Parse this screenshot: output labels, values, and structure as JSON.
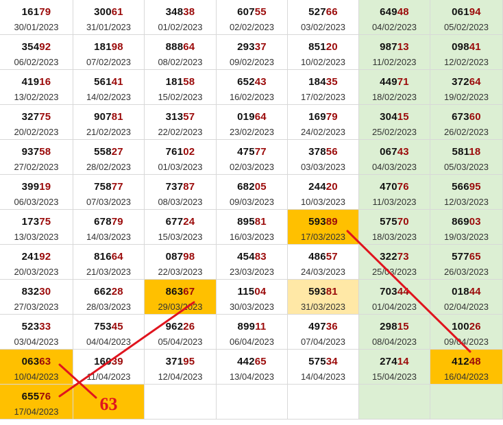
{
  "colors": {
    "weekend_bg": "#dcefd3",
    "highlight_bg": "#ffc000",
    "light_highlight_bg": "#ffe8a6",
    "digit_dark": "#111111",
    "digit_red": "#9b0a0a",
    "line_red": "#e0141e",
    "grid_line": "#d8d8d8"
  },
  "rows": [
    [
      {
        "first": "161",
        "last": "79",
        "date": "30/01/2023"
      },
      {
        "first": "300",
        "last": "61",
        "date": "31/01/2023"
      },
      {
        "first": "348",
        "last": "38",
        "date": "01/02/2023"
      },
      {
        "first": "607",
        "last": "55",
        "date": "02/02/2023"
      },
      {
        "first": "527",
        "last": "66",
        "date": "03/02/2023"
      },
      {
        "first": "649",
        "last": "48",
        "date": "04/02/2023"
      },
      {
        "first": "061",
        "last": "94",
        "date": "05/02/2023"
      }
    ],
    [
      {
        "first": "354",
        "last": "92",
        "date": "06/02/2023"
      },
      {
        "first": "181",
        "last": "98",
        "date": "07/02/2023"
      },
      {
        "first": "888",
        "last": "64",
        "date": "08/02/2023"
      },
      {
        "first": "293",
        "last": "37",
        "date": "09/02/2023"
      },
      {
        "first": "851",
        "last": "20",
        "date": "10/02/2023"
      },
      {
        "first": "987",
        "last": "13",
        "date": "11/02/2023"
      },
      {
        "first": "098",
        "last": "41",
        "date": "12/02/2023"
      }
    ],
    [
      {
        "first": "419",
        "last": "16",
        "date": "13/02/2023"
      },
      {
        "first": "561",
        "last": "41",
        "date": "14/02/2023"
      },
      {
        "first": "181",
        "last": "58",
        "date": "15/02/2023"
      },
      {
        "first": "652",
        "last": "43",
        "date": "16/02/2023"
      },
      {
        "first": "184",
        "last": "35",
        "date": "17/02/2023"
      },
      {
        "first": "449",
        "last": "71",
        "date": "18/02/2023"
      },
      {
        "first": "372",
        "last": "64",
        "date": "19/02/2023"
      }
    ],
    [
      {
        "first": "327",
        "last": "75",
        "date": "20/02/2023"
      },
      {
        "first": "907",
        "last": "81",
        "date": "21/02/2023"
      },
      {
        "first": "313",
        "last": "57",
        "date": "22/02/2023"
      },
      {
        "first": "019",
        "last": "64",
        "date": "23/02/2023"
      },
      {
        "first": "169",
        "last": "79",
        "date": "24/02/2023"
      },
      {
        "first": "304",
        "last": "15",
        "date": "25/02/2023"
      },
      {
        "first": "673",
        "last": "60",
        "date": "26/02/2023"
      }
    ],
    [
      {
        "first": "937",
        "last": "58",
        "date": "27/02/2023"
      },
      {
        "first": "558",
        "last": "27",
        "date": "28/02/2023"
      },
      {
        "first": "761",
        "last": "02",
        "date": "01/03/2023"
      },
      {
        "first": "475",
        "last": "77",
        "date": "02/03/2023"
      },
      {
        "first": "378",
        "last": "56",
        "date": "03/03/2023"
      },
      {
        "first": "067",
        "last": "43",
        "date": "04/03/2023"
      },
      {
        "first": "581",
        "last": "18",
        "date": "05/03/2023"
      }
    ],
    [
      {
        "first": "399",
        "last": "19",
        "date": "06/03/2023"
      },
      {
        "first": "758",
        "last": "77",
        "date": "07/03/2023"
      },
      {
        "first": "737",
        "last": "87",
        "date": "08/03/2023"
      },
      {
        "first": "682",
        "last": "05",
        "date": "09/03/2023"
      },
      {
        "first": "244",
        "last": "20",
        "date": "10/03/2023"
      },
      {
        "first": "470",
        "last": "76",
        "date": "11/03/2023"
      },
      {
        "first": "566",
        "last": "95",
        "date": "12/03/2023"
      }
    ],
    [
      {
        "first": "173",
        "last": "75",
        "date": "13/03/2023"
      },
      {
        "first": "678",
        "last": "79",
        "date": "14/03/2023"
      },
      {
        "first": "677",
        "last": "24",
        "date": "15/03/2023"
      },
      {
        "first": "895",
        "last": "81",
        "date": "16/03/2023"
      },
      {
        "first": "593",
        "last": "89",
        "date": "17/03/2023",
        "hl": "strong"
      },
      {
        "first": "575",
        "last": "70",
        "date": "18/03/2023"
      },
      {
        "first": "869",
        "last": "03",
        "date": "19/03/2023"
      }
    ],
    [
      {
        "first": "241",
        "last": "92",
        "date": "20/03/2023"
      },
      {
        "first": "816",
        "last": "64",
        "date": "21/03/2023"
      },
      {
        "first": "087",
        "last": "98",
        "date": "22/03/2023"
      },
      {
        "first": "454",
        "last": "83",
        "date": "23/03/2023"
      },
      {
        "first": "486",
        "last": "57",
        "date": "24/03/2023"
      },
      {
        "first": "322",
        "last": "73",
        "date": "25/03/2023"
      },
      {
        "first": "577",
        "last": "65",
        "date": "26/03/2023"
      }
    ],
    [
      {
        "first": "832",
        "last": "30",
        "date": "27/03/2023"
      },
      {
        "first": "662",
        "last": "28",
        "date": "28/03/2023"
      },
      {
        "first": "863",
        "last": "67",
        "date": "29/03/2023",
        "hl": "strong"
      },
      {
        "first": "115",
        "last": "04",
        "date": "30/03/2023"
      },
      {
        "first": "593",
        "last": "81",
        "date": "31/03/2023",
        "hl": "light"
      },
      {
        "first": "703",
        "last": "44",
        "date": "01/04/2023"
      },
      {
        "first": "018",
        "last": "44",
        "date": "02/04/2023"
      }
    ],
    [
      {
        "first": "523",
        "last": "33",
        "date": "03/04/2023"
      },
      {
        "first": "753",
        "last": "45",
        "date": "04/04/2023"
      },
      {
        "first": "962",
        "last": "26",
        "date": "05/04/2023"
      },
      {
        "first": "899",
        "last": "11",
        "date": "06/04/2023"
      },
      {
        "first": "497",
        "last": "36",
        "date": "07/04/2023"
      },
      {
        "first": "298",
        "last": "15",
        "date": "08/04/2023"
      },
      {
        "first": "100",
        "last": "26",
        "date": "09/04/2023"
      }
    ],
    [
      {
        "first": "063",
        "last": "63",
        "date": "10/04/2023",
        "hl": "strong"
      },
      {
        "first": "160",
        "last": "39",
        "date": "11/04/2023"
      },
      {
        "first": "371",
        "last": "95",
        "date": "12/04/2023"
      },
      {
        "first": "442",
        "last": "65",
        "date": "13/04/2023"
      },
      {
        "first": "575",
        "last": "34",
        "date": "14/04/2023"
      },
      {
        "first": "274",
        "last": "14",
        "date": "15/04/2023"
      },
      {
        "first": "412",
        "last": "48",
        "date": "16/04/2023",
        "hl": "strong"
      }
    ],
    [
      {
        "first": "655",
        "last": "76",
        "date": "17/04/2023",
        "hl": "strong"
      },
      {
        "text": "63",
        "hl": "strong"
      },
      {},
      {},
      {},
      {},
      {}
    ]
  ]
}
